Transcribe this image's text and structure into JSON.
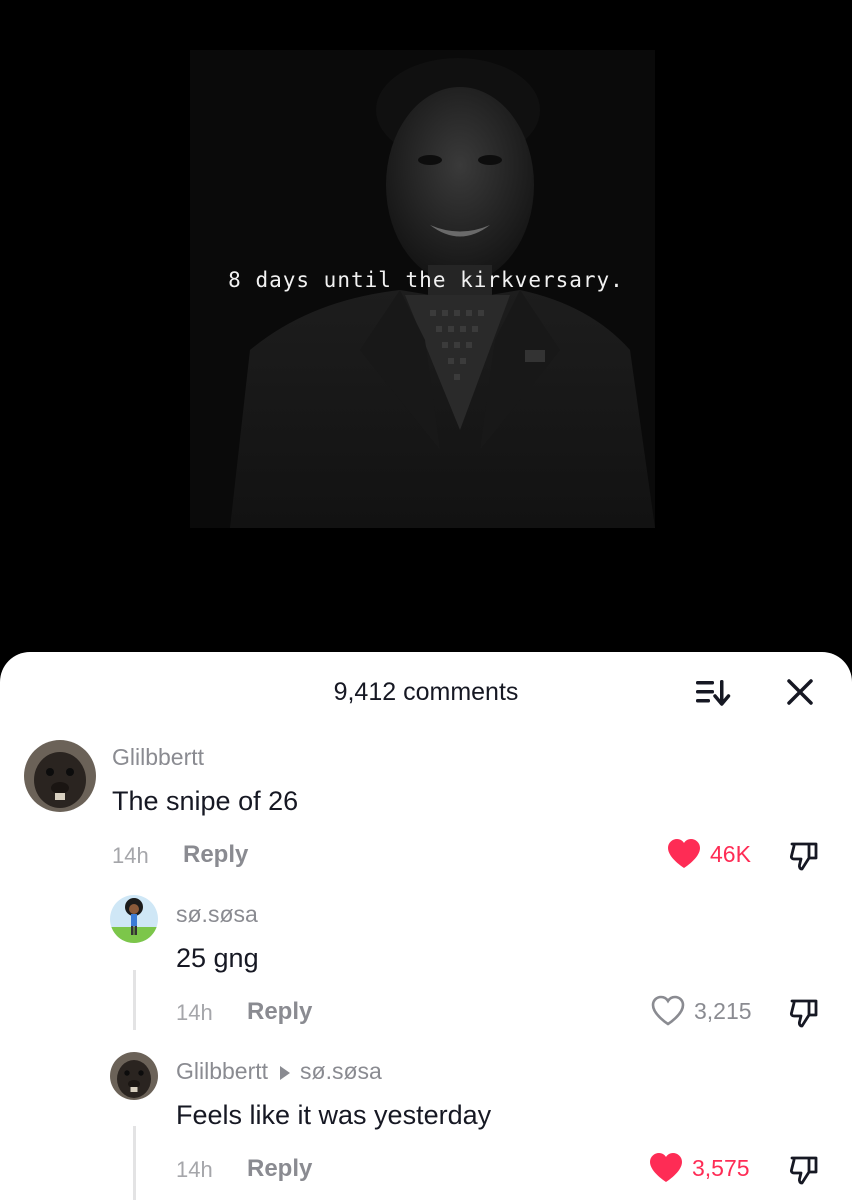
{
  "video": {
    "overlay_text": "8 days until the kirkversary."
  },
  "comments_sheet": {
    "title": "9,412 comments",
    "sort_icon": "sort-icon",
    "close_icon": "close-icon",
    "accent_color": "#fe2c55"
  },
  "comments": [
    {
      "username": "Glilbbertt",
      "text": "The snipe of 26",
      "time": "14h",
      "reply_label": "Reply",
      "likes": "46K",
      "liked": true
    },
    {
      "username": "sø.søsa",
      "text": "25 gng",
      "time": "14h",
      "reply_label": "Reply",
      "likes": "3,215",
      "liked": false
    },
    {
      "username": "Glilbbertt",
      "reply_to": "sø.søsa",
      "text": "Feels like it was yesterday",
      "time": "14h",
      "reply_label": "Reply",
      "likes": "3,575",
      "liked": true
    }
  ]
}
